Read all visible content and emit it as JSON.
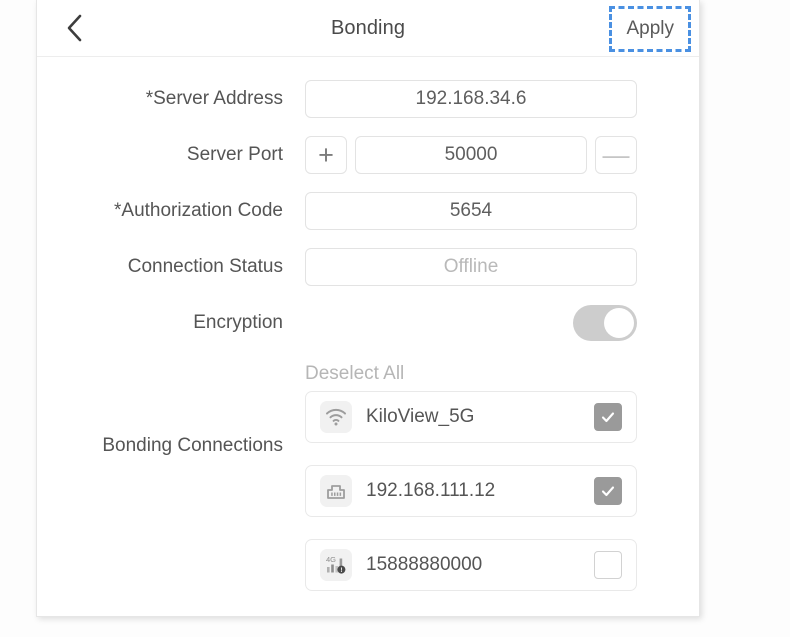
{
  "header": {
    "back_icon": "chevron-left-icon",
    "title": "Bonding",
    "apply_label": "Apply",
    "apply_focus_color": "#4a90e2"
  },
  "form": {
    "rows": [
      {
        "label": "*Server Address",
        "type": "text",
        "value": "192.168.34.6",
        "readonly": false
      },
      {
        "label": "Server Port",
        "type": "stepper",
        "value": "50000",
        "plus": "+",
        "minus": "—"
      },
      {
        "label": "*Authorization Code",
        "type": "text",
        "value": "5654",
        "readonly": false
      },
      {
        "label": "Connection Status",
        "type": "text",
        "value": "Offline",
        "readonly": true
      },
      {
        "label": "Encryption",
        "type": "toggle",
        "value": "on",
        "track_color": "#cdcdcd"
      }
    ]
  },
  "bonding": {
    "label": "Bonding Connections",
    "deselect_all_label": "Deselect All",
    "items": [
      {
        "icon": "wifi-icon",
        "name": "KiloView_5G",
        "checked": true
      },
      {
        "icon": "ethernet-icon",
        "name": "192.168.111.12",
        "checked": true
      },
      {
        "icon": "cellular-4g-icon",
        "name": "15888880000",
        "checked": false
      }
    ]
  }
}
